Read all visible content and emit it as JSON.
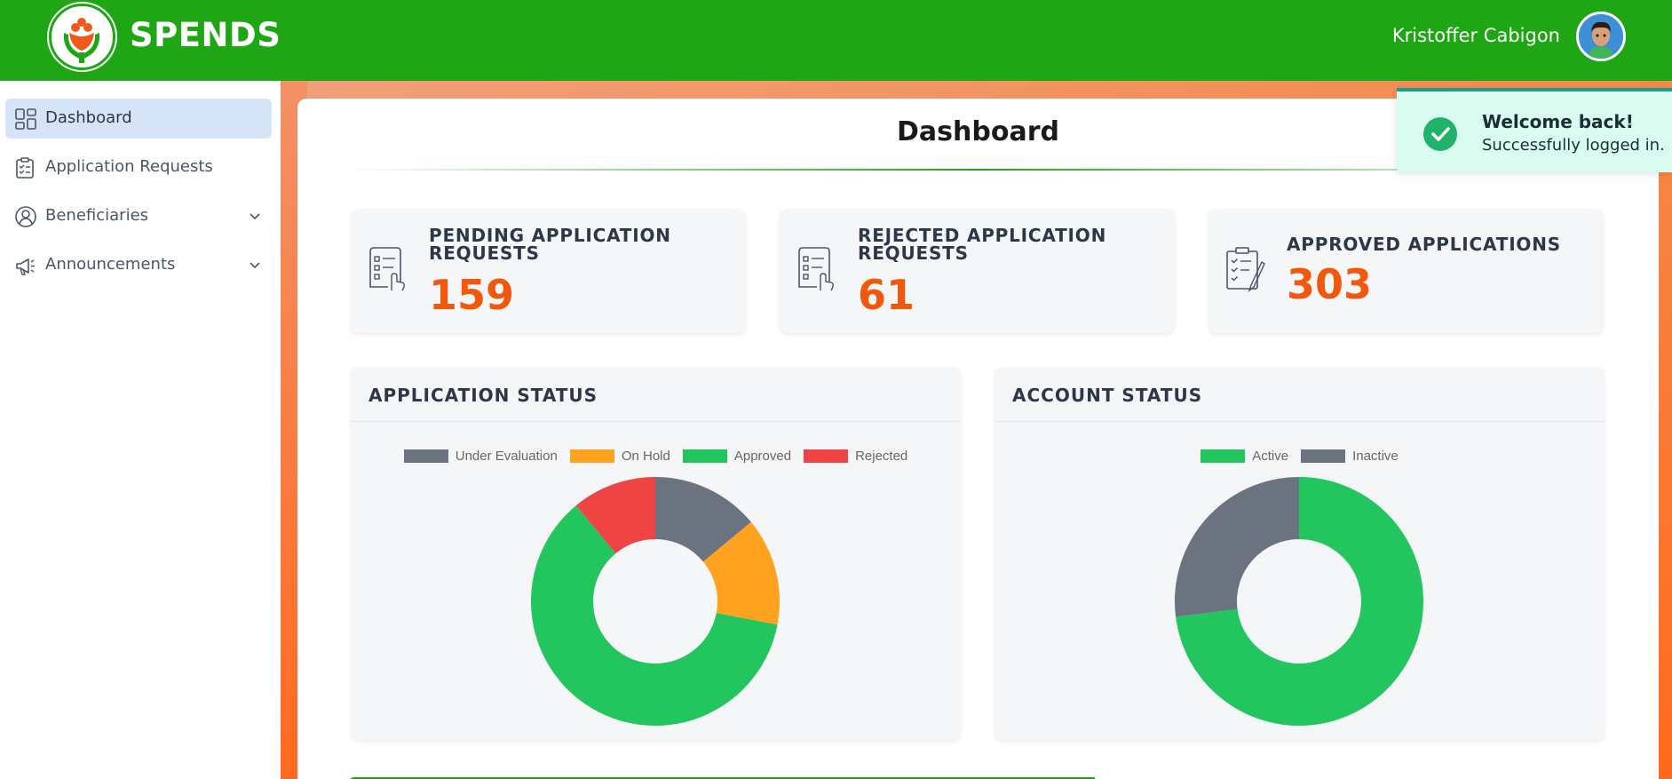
{
  "header": {
    "brand": "SPENDS",
    "user_name": "Kristoffer Cabigon",
    "brand_color": "#1ea614"
  },
  "sidebar": {
    "items": [
      {
        "label": "Dashboard",
        "icon": "dashboard-icon",
        "active": true
      },
      {
        "label": "Application Requests",
        "icon": "clipboard-icon",
        "active": false
      },
      {
        "label": "Beneficiaries",
        "icon": "user-circle-icon",
        "has_submenu": true
      },
      {
        "label": "Announcements",
        "icon": "megaphone-icon",
        "has_submenu": true
      }
    ]
  },
  "main": {
    "title": "Dashboard",
    "stats": [
      {
        "label": "PENDING APPLICATION REQUESTS",
        "value": "159",
        "icon": "document-list-icon"
      },
      {
        "label": "REJECTED APPLICATION REQUESTS",
        "value": "61",
        "icon": "document-list-icon"
      },
      {
        "label": "APPROVED APPLICATIONS",
        "value": "303",
        "icon": "checklist-icon"
      }
    ],
    "accent_color": "#f2580c"
  },
  "chart_data": [
    {
      "type": "pie",
      "title": "APPLICATION STATUS",
      "categories": [
        "Under Evaluation",
        "On Hold",
        "Approved",
        "Rejected"
      ],
      "values": [
        14,
        14,
        61,
        11
      ],
      "colors": [
        "#6b7280",
        "#ffa21f",
        "#22c55e",
        "#ef4444"
      ],
      "legend": "top"
    },
    {
      "type": "pie",
      "title": "ACCOUNT STATUS",
      "categories": [
        "Active",
        "Inactive"
      ],
      "values": [
        73,
        27
      ],
      "colors": [
        "#22c55e",
        "#6b7280"
      ],
      "legend": "top"
    }
  ],
  "toast": {
    "title": "Welcome back!",
    "message": "Successfully logged in.",
    "icon": "check-circle-icon"
  }
}
